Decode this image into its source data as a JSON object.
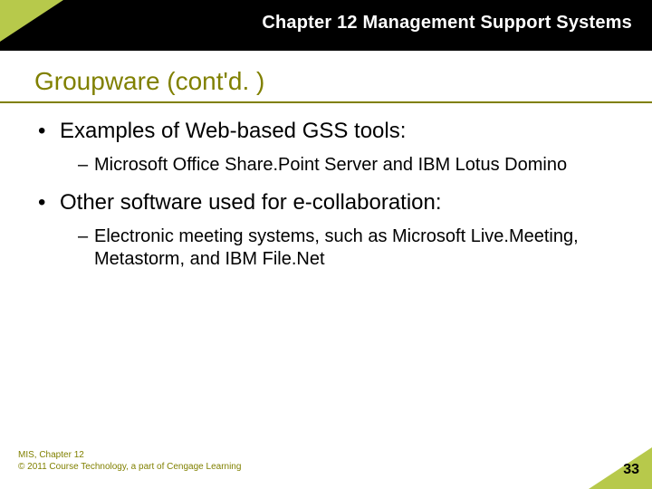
{
  "header": {
    "chapter_title": "Chapter 12 Management Support Systems"
  },
  "title": "Groupware (cont'd. )",
  "content": {
    "bullets": [
      {
        "text": "Examples of Web-based GSS tools:",
        "sub": [
          "Microsoft Office Share.Point Server and IBM Lotus Domino"
        ]
      },
      {
        "text": "Other software used for e-collaboration:",
        "sub": [
          "Electronic meeting systems, such as Microsoft Live.Meeting, Metastorm, and IBM File.Net"
        ]
      }
    ]
  },
  "footer": {
    "line1": "MIS, Chapter 12",
    "line2": "© 2011 Course Technology, a part of Cengage Learning",
    "page": "33"
  }
}
